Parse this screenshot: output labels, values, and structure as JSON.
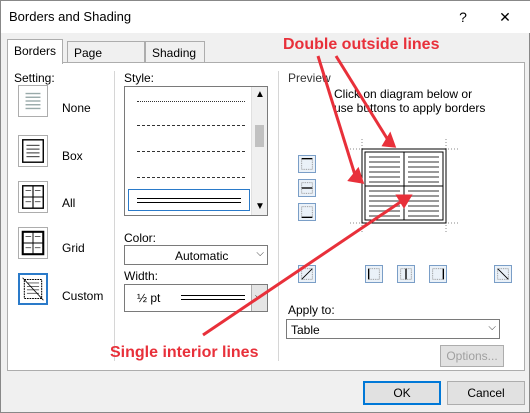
{
  "window": {
    "title": "Borders and Shading",
    "help_label": "?",
    "close_label": "✕"
  },
  "tabs": [
    {
      "label": "Borders",
      "active": true
    },
    {
      "label": "Page Border",
      "active": false
    },
    {
      "label": "Shading",
      "active": false
    }
  ],
  "setting": {
    "heading": "Setting:",
    "items": [
      {
        "label": "None",
        "selected": false
      },
      {
        "label": "Box",
        "selected": false
      },
      {
        "label": "All",
        "selected": false
      },
      {
        "label": "Grid",
        "selected": false
      },
      {
        "label": "Custom",
        "selected": true
      }
    ]
  },
  "style": {
    "heading": "Style:"
  },
  "color": {
    "heading": "Color:",
    "value": "Automatic"
  },
  "width": {
    "heading": "Width:",
    "value": "½ pt"
  },
  "preview": {
    "heading": "Preview",
    "instruction_line1": "Click on diagram below or",
    "instruction_line2": "use buttons to apply borders"
  },
  "apply_to": {
    "heading": "Apply to:",
    "value": "Table"
  },
  "buttons": {
    "options": "Options...",
    "ok": "OK",
    "cancel": "Cancel"
  },
  "annotations": {
    "double_outside": "Double outside lines",
    "single_interior": "Single interior lines",
    "color": "#e8303a"
  }
}
